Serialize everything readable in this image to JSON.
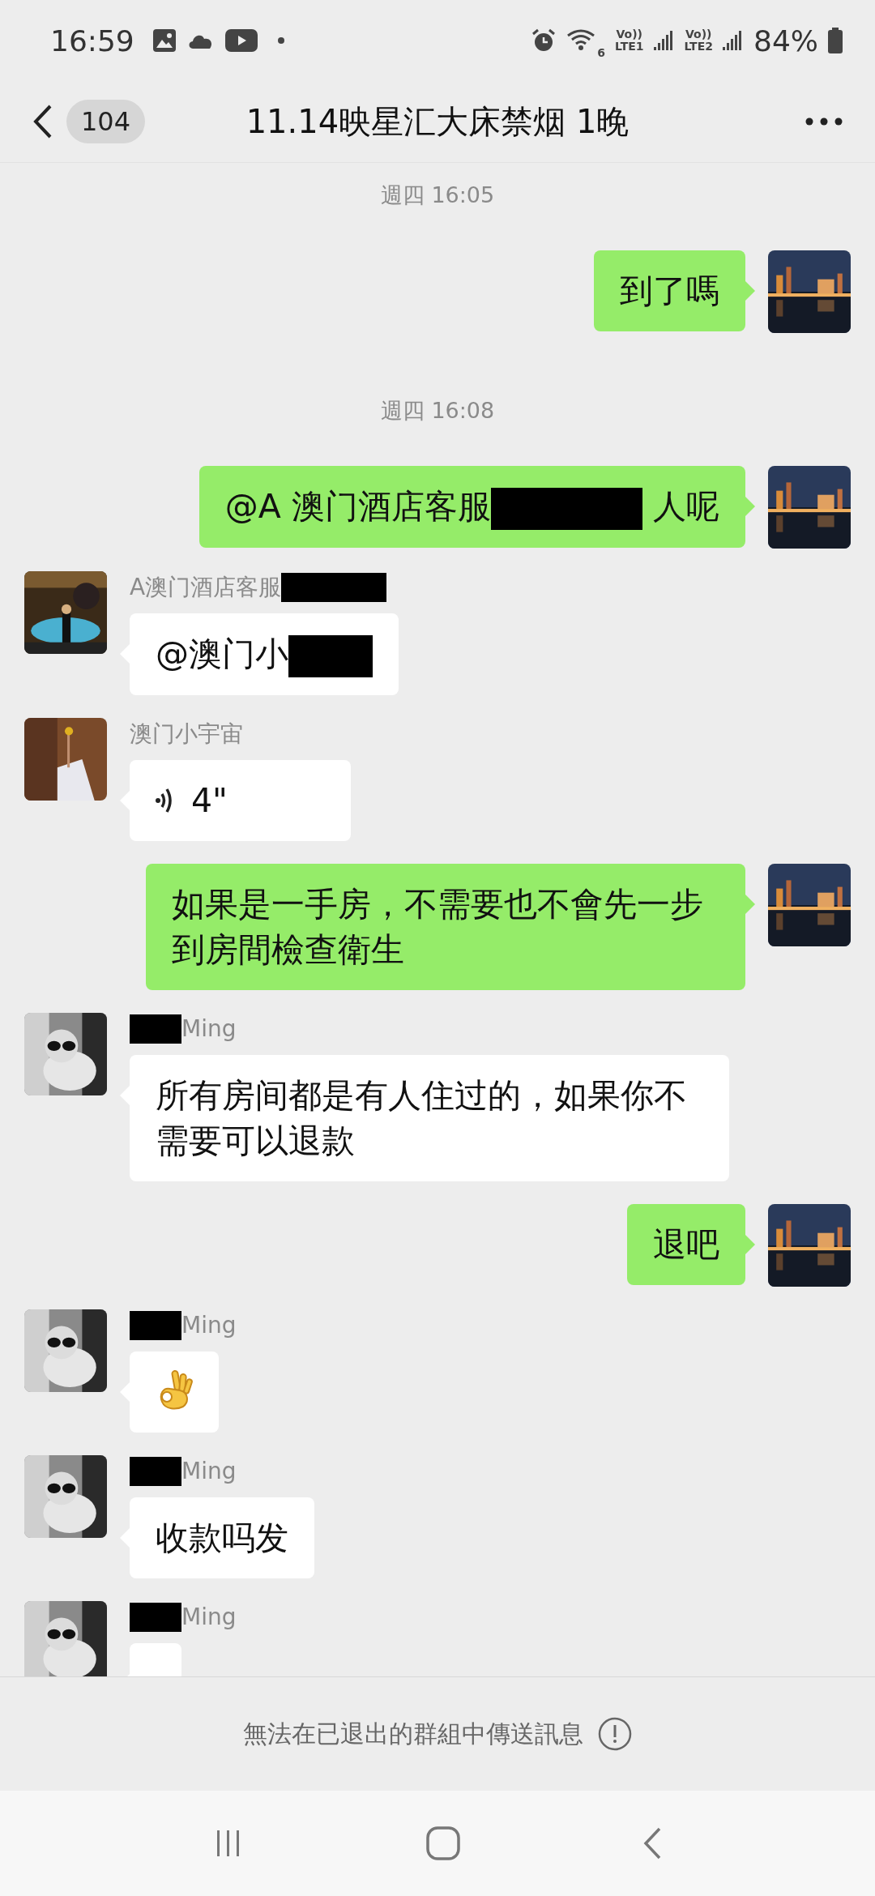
{
  "status_bar": {
    "time": "16:59",
    "wifi_label": "6",
    "network_labels": [
      {
        "top": "Vo))",
        "bottom": "LTE1"
      },
      {
        "top": "Vo))",
        "bottom": "LTE2"
      }
    ],
    "battery": "84%"
  },
  "header": {
    "unread_badge": "104",
    "title": "11.14映星汇大床禁烟 1晚"
  },
  "messages": [
    {
      "kind": "time",
      "text": "週四 16:05"
    },
    {
      "kind": "text",
      "outgoing": true,
      "parts": [
        {
          "kind": "text",
          "text": "到了嗎"
        }
      ]
    },
    {
      "kind": "time",
      "text": "週四 16:08"
    },
    {
      "kind": "text",
      "outgoing": true,
      "parts": [
        {
          "kind": "text",
          "text": "@A 澳门酒店客服"
        },
        {
          "kind": "redaction"
        },
        {
          "kind": "text",
          "text": " 人呢"
        }
      ]
    },
    {
      "kind": "text",
      "outgoing": false,
      "sender": [
        {
          "kind": "text",
          "text": "A澳门酒店客服"
        },
        {
          "kind": "redaction"
        }
      ],
      "parts": [
        {
          "kind": "text",
          "text": "@澳门小"
        },
        {
          "kind": "redaction"
        }
      ]
    },
    {
      "kind": "voice",
      "outgoing": false,
      "sender": [
        {
          "kind": "text",
          "text": "澳门小宇宙"
        }
      ],
      "duration": "4\""
    },
    {
      "kind": "text",
      "outgoing": true,
      "parts": [
        {
          "kind": "text",
          "text": "如果是一手房，不需要也不會先一步到房間檢查衛生"
        }
      ]
    },
    {
      "kind": "text",
      "outgoing": false,
      "sender": [
        {
          "kind": "redaction"
        },
        {
          "kind": "text",
          "text": "Ming"
        }
      ],
      "parts": [
        {
          "kind": "text",
          "text": "所有房间都是有人住过的，如果你不需要可以退款"
        }
      ]
    },
    {
      "kind": "text",
      "outgoing": true,
      "parts": [
        {
          "kind": "text",
          "text": "退吧"
        }
      ]
    },
    {
      "kind": "emoji",
      "outgoing": false,
      "sender": [
        {
          "kind": "redaction"
        },
        {
          "kind": "text",
          "text": "Ming"
        }
      ]
    },
    {
      "kind": "text",
      "outgoing": false,
      "sender": [
        {
          "kind": "redaction"
        },
        {
          "kind": "text",
          "text": "Ming"
        }
      ],
      "parts": [
        {
          "kind": "text",
          "text": "收款吗发"
        }
      ]
    },
    {
      "kind": "text",
      "outgoing": false,
      "sender": [
        {
          "kind": "redaction"
        },
        {
          "kind": "text",
          "text": "Ming"
        }
      ]
    }
  ],
  "notice": "無法在已退出的群組中傳送訊息"
}
